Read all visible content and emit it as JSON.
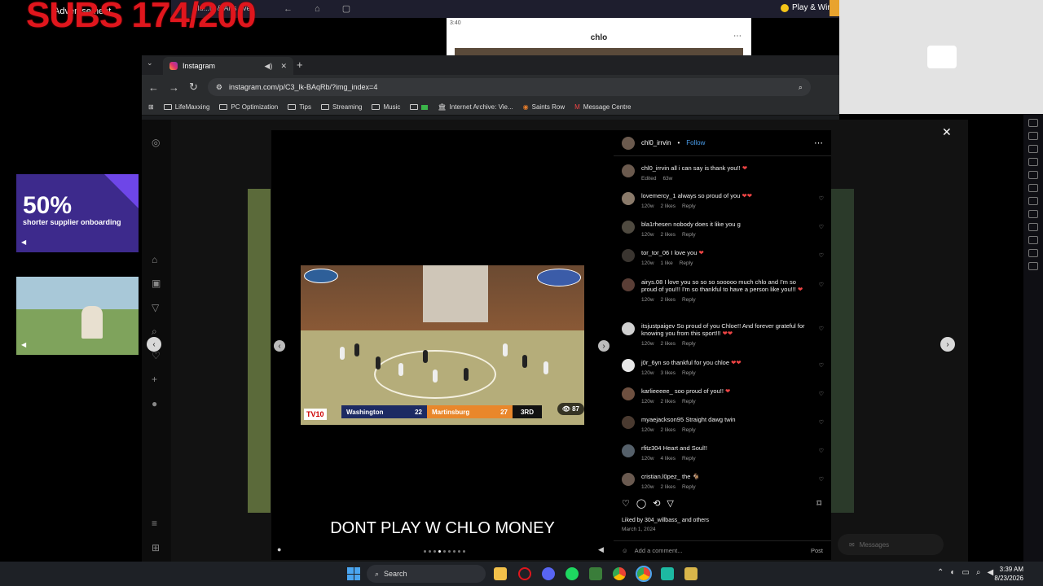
{
  "background": {
    "banner": "SUBS 174/200",
    "ad_label": "Advertisement",
    "tab_title": "Illu...ts & Arts over",
    "play_win": "Play & Win",
    "phone_time": "3:40",
    "phone_name": "chlo",
    "side_ad1_pct": "50%",
    "side_ad1_text": "shorter supplier onboarding"
  },
  "browser": {
    "tab_label": "Instagram",
    "url": "instagram.com/p/C3_lk-BAqRb/?img_index=4",
    "bookmarks": [
      "LifeMaxxing",
      "PC Optimization",
      "Tips",
      "Streaming",
      "Music",
      "",
      "Internet Archive: Vie...",
      "Saints Row",
      "Message Centre"
    ]
  },
  "video": {
    "team1": "Washington",
    "score1": "22",
    "team2": "Martinsburg",
    "score2": "27",
    "period": "3RD",
    "network": "TV10",
    "views": "87"
  },
  "caption": "DONT PLAY W CHLO MONEY",
  "panel": {
    "username": "chl0_irrvin",
    "follow": "Follow",
    "comments": [
      {
        "user": "chl0_irrvin",
        "text": "all i can say is thank you!!",
        "meta": [
          "Edited",
          "63w"
        ]
      },
      {
        "user": "lovemercy_1",
        "text": "always so proud of you",
        "meta": [
          "120w",
          "2 likes",
          "Reply"
        ]
      },
      {
        "user": "bla1rhesen",
        "text": "nobody does it like you g",
        "meta": [
          "120w",
          "2 likes",
          "Reply"
        ]
      },
      {
        "user": "tor_tor_06",
        "text": "I love you",
        "meta": [
          "120w",
          "1 like",
          "Reply"
        ]
      },
      {
        "user": "airys.08",
        "text": "I love you so so so sooooo much chlo and I'm so proud of you!!! I'm so thankful to have a person like you!!!",
        "meta": [
          "120w",
          "2 likes",
          "Reply"
        ]
      },
      {
        "user": "itsjustpaigev",
        "text": "So proud of you Chloe!! And forever grateful for knowing you from this sport!!!",
        "meta": [
          "120w",
          "2 likes",
          "Reply"
        ]
      },
      {
        "user": "j0r_6yn",
        "text": "so thankful for you chloe",
        "meta": [
          "120w",
          "3 likes",
          "Reply"
        ]
      },
      {
        "user": "karlieeeee_",
        "text": "soo proud of you!!",
        "meta": [
          "120w",
          "2 likes",
          "Reply"
        ]
      },
      {
        "user": "myaejackson95",
        "text": "Straight dawg twin",
        "meta": [
          "120w",
          "2 likes",
          "Reply"
        ]
      },
      {
        "user": "rfitz304",
        "text": "Heart and Soul!!",
        "meta": [
          "120w",
          "4 likes",
          "Reply"
        ]
      },
      {
        "user": "cristian.l0pez_",
        "text": "the",
        "meta": [
          "120w",
          "2 likes",
          "Reply"
        ]
      }
    ],
    "likes": "Liked by 304_willbass_ and others",
    "date": "March 1, 2024",
    "add_comment": "Add a comment...",
    "post": "Post",
    "messages": "Messages"
  },
  "taskbar": {
    "search": "Search",
    "time": "3:39 AM",
    "date": "8/23/2026"
  },
  "colors": {
    "accent": "#4aa5f0",
    "instagram_link": "#4a9eed",
    "banner_red": "#e0161d"
  }
}
